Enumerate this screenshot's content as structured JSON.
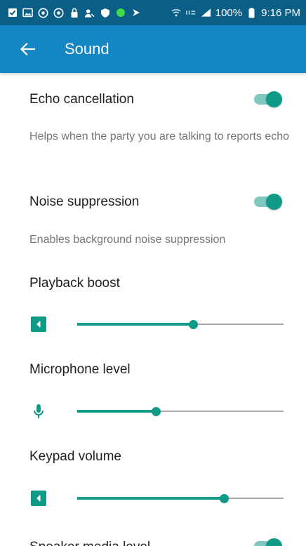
{
  "status_bar": {
    "battery": "100%",
    "time": "9:16 PM",
    "left_icons": [
      "checkbox-icon",
      "image-icon",
      "chrome-icon",
      "chrome-icon",
      "lock-icon",
      "profile-icon",
      "shield-icon",
      "green-dot-icon",
      "play-icon"
    ]
  },
  "app_bar": {
    "title": "Sound",
    "color": "#1486c4"
  },
  "accent": "#0e9a86",
  "settings": {
    "echo": {
      "label": "Echo cancellation",
      "desc": "Helps when the party you are talking to reports echo",
      "on": true
    },
    "noise": {
      "label": "Noise suppression",
      "desc": "Enables background noise suppression",
      "on": true
    },
    "playback": {
      "label": "Playback boost",
      "icon": "speaker-icon",
      "level": 0.56
    },
    "mic": {
      "label": "Microphone level",
      "icon": "microphone-icon",
      "level": 0.38
    },
    "keypad": {
      "label": "Keypad volume",
      "icon": "speaker-icon",
      "level": 0.71
    },
    "partial": {
      "label": "Speaker media level",
      "on": true
    }
  }
}
